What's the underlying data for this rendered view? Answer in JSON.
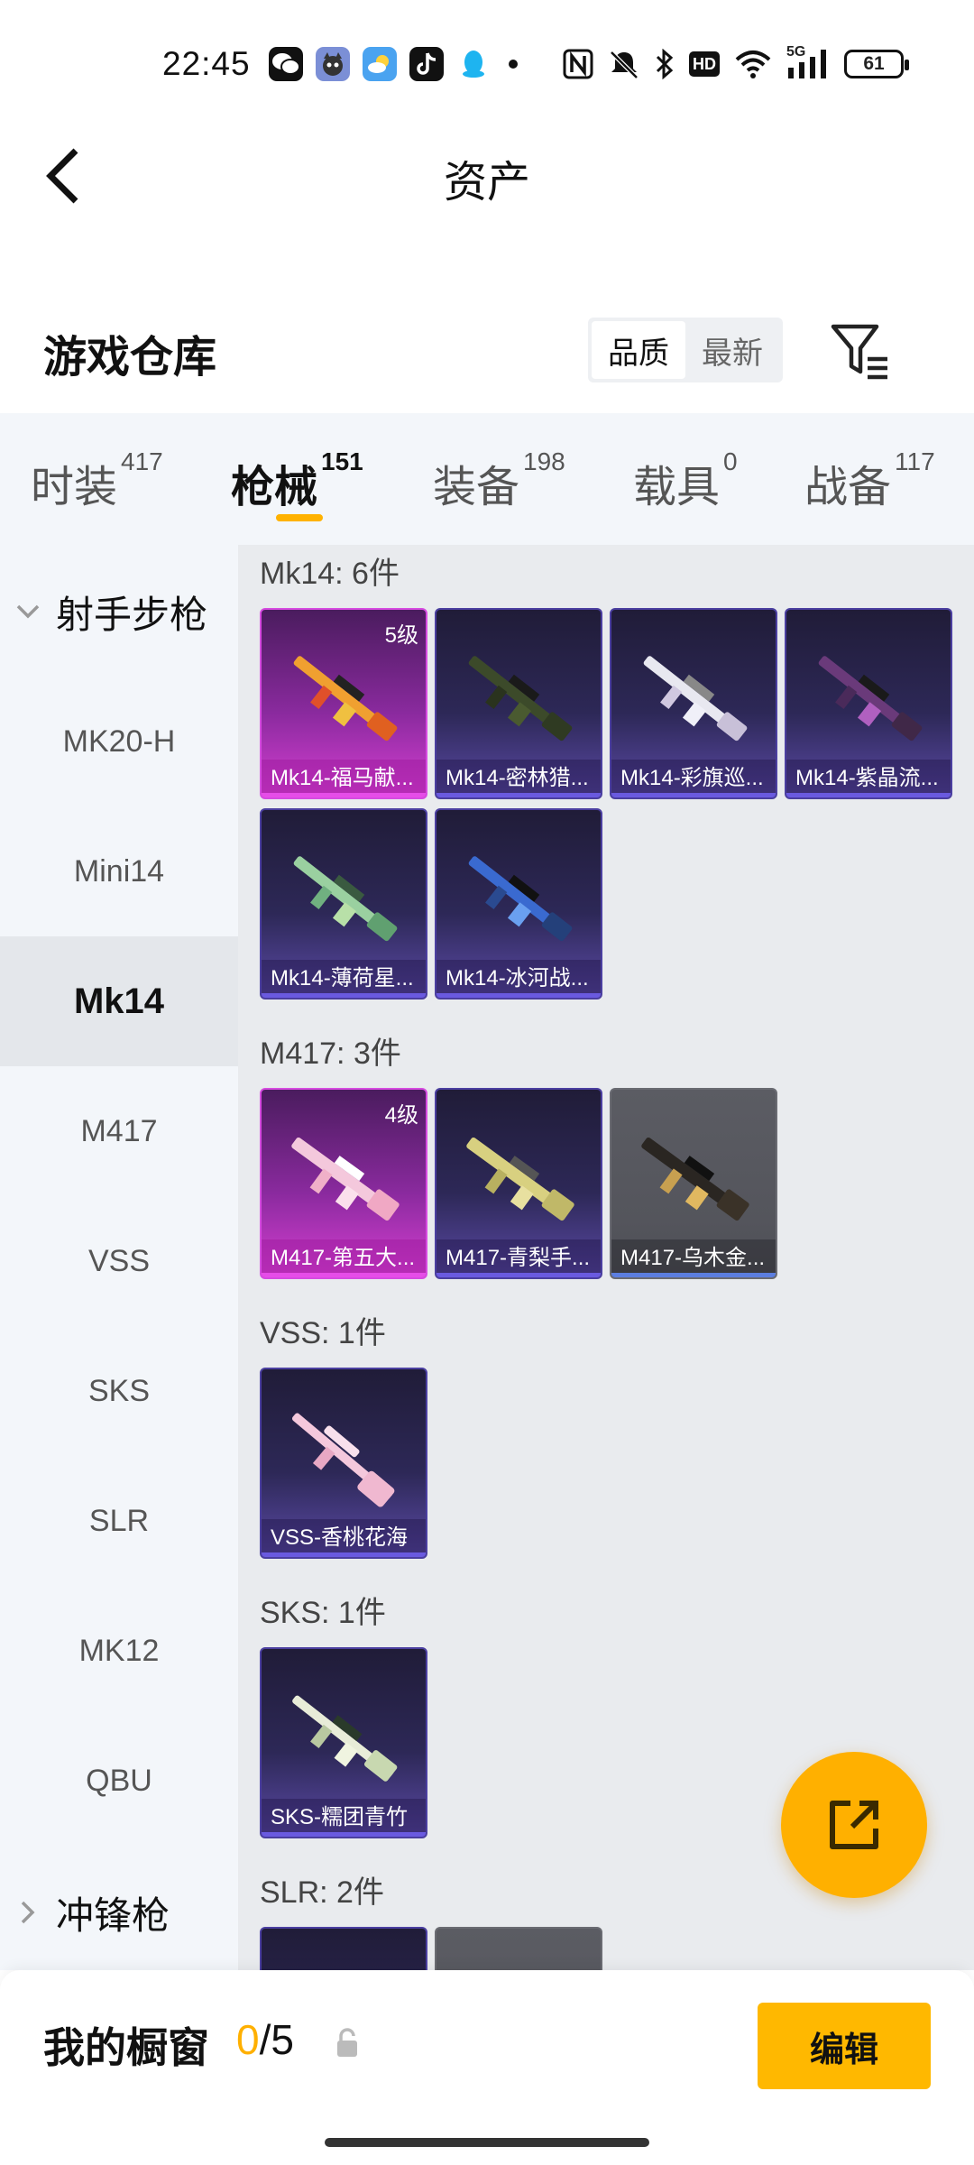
{
  "status_bar": {
    "time": "22:45",
    "notification_icons": [
      "wechat-icon",
      "cat-app-icon",
      "weather-icon",
      "tiktok-icon",
      "qq-icon",
      "dot-icon"
    ],
    "system_icons": [
      "nfc-icon",
      "mute-icon",
      "bluetooth-icon",
      "hd-icon",
      "wifi-icon",
      "5g-signal-icon"
    ],
    "hd_label": "HD",
    "net_label": "5G",
    "battery": "61"
  },
  "header": {
    "title": "资产"
  },
  "warehouse": {
    "title": "游戏仓库",
    "sort_options": [
      "品质",
      "最新"
    ],
    "active_sort": "品质"
  },
  "tabs": [
    {
      "label": "时装",
      "count": "417"
    },
    {
      "label": "枪械",
      "count": "151"
    },
    {
      "label": "装备",
      "count": "198"
    },
    {
      "label": "载具",
      "count": "0"
    },
    {
      "label": "战备",
      "count": "117"
    }
  ],
  "sidebar": {
    "group_open": "射手步枪",
    "items": [
      "MK20-H",
      "Mini14",
      "Mk14",
      "M417",
      "VSS",
      "SKS",
      "SLR",
      "MK12",
      "QBU"
    ],
    "active_item": "Mk14",
    "group_closed": "冲锋枪"
  },
  "sections": [
    {
      "title": "Mk14: 6件",
      "items": [
        {
          "name": "Mk14-福马献...",
          "level": "5级",
          "tier": "pink"
        },
        {
          "name": "Mk14-密林猎...",
          "level": "",
          "tier": "purple"
        },
        {
          "name": "Mk14-彩旗巡...",
          "level": "",
          "tier": "purple"
        },
        {
          "name": "Mk14-紫晶流...",
          "level": "",
          "tier": "purple"
        },
        {
          "name": "Mk14-薄荷星...",
          "level": "",
          "tier": "purple"
        },
        {
          "name": "Mk14-冰河战...",
          "level": "",
          "tier": "purple"
        }
      ]
    },
    {
      "title": "M417: 3件",
      "items": [
        {
          "name": "M417-第五大...",
          "level": "4级",
          "tier": "pink"
        },
        {
          "name": "M417-青梨手...",
          "level": "",
          "tier": "purple"
        },
        {
          "name": "M417-乌木金...",
          "level": "",
          "tier": "gray"
        }
      ]
    },
    {
      "title": "VSS: 1件",
      "items": [
        {
          "name": "VSS-香桃花海",
          "level": "",
          "tier": "purple"
        }
      ]
    },
    {
      "title": "SKS: 1件",
      "items": [
        {
          "name": "SKS-糯团青竹",
          "level": "",
          "tier": "purple"
        }
      ]
    },
    {
      "title": "SLR: 2件",
      "items": []
    }
  ],
  "showcase": {
    "label": "我的橱窗",
    "used": "0",
    "separator": "/",
    "total": "5",
    "edit_label": "编辑"
  },
  "colors": {
    "accent": "#ffb000",
    "tier_pink": "#d63fd2",
    "tier_purple": "#5b4aa6",
    "tier_gray": "#54555c"
  }
}
